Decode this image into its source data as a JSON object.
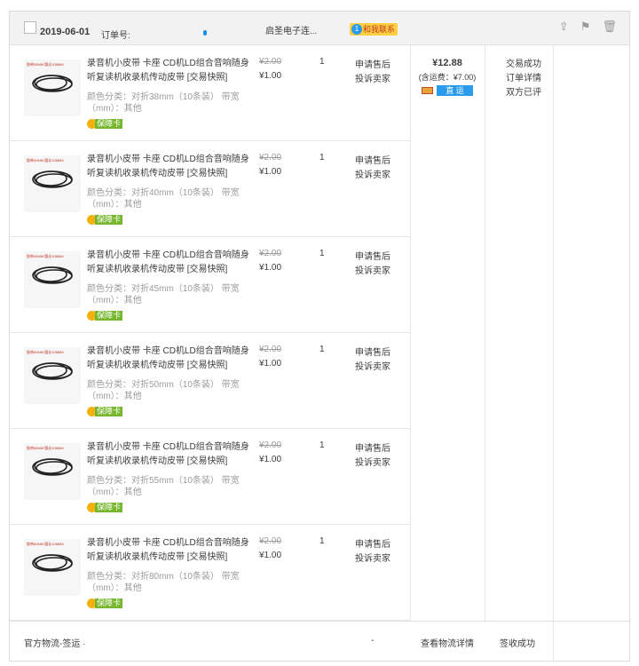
{
  "header": {
    "date": "2019-06-01",
    "order_label": "订单号:",
    "shop_name": "启圣电子连...",
    "contact_badge": "1",
    "contact_label": "和我联系",
    "icons": [
      "share-icon",
      "flag-icon",
      "trash-icon"
    ]
  },
  "items": [
    {
      "thumb_caption": "胶带38MM 圆长108MM",
      "title": "录音机小皮带 卡座 CD机LD组合音响随身听复读机收录机传动皮带 [交易快照]",
      "spec": "颜色分类：对折38mm（10条装） 带宽（mm）：其他",
      "guarantee": "保障卡",
      "original_price": "¥2.00",
      "price": "¥1.00",
      "qty": "1",
      "action1": "申请售后",
      "action2": "投诉卖家"
    },
    {
      "thumb_caption": "胶带40MM 圆长108MM",
      "title": "录音机小皮带 卡座 CD机LD组合音响随身听复读机收录机传动皮带 [交易快照]",
      "spec": "颜色分类：对折40mm（10条装） 带宽（mm）：其他",
      "guarantee": "保障卡",
      "original_price": "¥2.00",
      "price": "¥1.00",
      "qty": "1",
      "action1": "申请售后",
      "action2": "投诉卖家"
    },
    {
      "thumb_caption": "胶带45MM 圆长108MM",
      "title": "录音机小皮带 卡座 CD机LD组合音响随身听复读机收录机传动皮带 [交易快照]",
      "spec": "颜色分类：对折45mm（10条装） 带宽（mm）：其他",
      "guarantee": "保障卡",
      "original_price": "¥2.00",
      "price": "¥1.00",
      "qty": "1",
      "action1": "申请售后",
      "action2": "投诉卖家"
    },
    {
      "thumb_caption": "胶带50MM 圆长108MM",
      "title": "录音机小皮带 卡座 CD机LD组合音响随身听复读机收录机传动皮带 [交易快照]",
      "spec": "颜色分类：对折50mm（10条装） 带宽（mm）：其他",
      "guarantee": "保障卡",
      "original_price": "¥2.00",
      "price": "¥1.00",
      "qty": "1",
      "action1": "申请售后",
      "action2": "投诉卖家"
    },
    {
      "thumb_caption": "胶带55MM 圆长108MM",
      "title": "录音机小皮带 卡座 CD机LD组合音响随身听复读机收录机传动皮带 [交易快照]",
      "spec": "颜色分类：对折55mm（10条装） 带宽（mm）：其他",
      "guarantee": "保障卡",
      "original_price": "¥2.00",
      "price": "¥1.00",
      "qty": "1",
      "action1": "申请售后",
      "action2": "投诉卖家"
    },
    {
      "thumb_caption": "胶带80MM 圆长108MM",
      "title": "录音机小皮带 卡座 CD机LD组合音响随身听复读机收录机传动皮带 [交易快照]",
      "spec": "颜色分类：对折80mm（10条装） 带宽（mm）：其他",
      "guarantee": "保障卡",
      "original_price": "¥2.00",
      "price": "¥1.00",
      "qty": "1",
      "action1": "申请售后",
      "action2": "投诉卖家"
    }
  ],
  "summary": {
    "total": "¥12.88",
    "shipping": "(含运费：¥7.00)",
    "ship_mode": "直 运"
  },
  "status": {
    "line1": "交易成功",
    "line2": "订单详情",
    "line3": "双方已评"
  },
  "footer": {
    "logistics": "官方物流-签运 ·",
    "dash": "-",
    "view_logistics": "查看物流详情",
    "signed": "签收成功"
  }
}
